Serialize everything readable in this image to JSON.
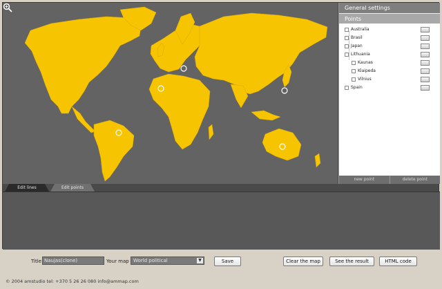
{
  "map": {
    "zoom_icon": "magnifier-zoom-icon",
    "land_color": "#f6c400",
    "water_color": "#636363",
    "point_marker": "location-marker-icon"
  },
  "panel": {
    "general_settings": "General settings",
    "points_header": "Points",
    "items": [
      {
        "label": "Australia",
        "level": 0
      },
      {
        "label": "Brasil",
        "level": 0
      },
      {
        "label": "Japan",
        "level": 0
      },
      {
        "label": "Lithuania",
        "level": 0
      },
      {
        "label": "Kaunas",
        "level": 1
      },
      {
        "label": "Klaipeda",
        "level": 1
      },
      {
        "label": "Vilnius",
        "level": 1
      },
      {
        "label": "Spain",
        "level": 0
      }
    ],
    "new_point": "new point",
    "delete_point": "delete point"
  },
  "tabs": [
    "Edit lines",
    "Edit points"
  ],
  "form": {
    "title_label": "Title",
    "title_value": "Naujas(clone)",
    "map_label": "Your map",
    "map_value": "World political",
    "save": "Save",
    "clear_map": "Clear the map",
    "see_result": "See the result",
    "html_code": "HTML code"
  },
  "footer": "© 2004 amstudio tel: +370 5 26 26 080 info@ammap.com"
}
